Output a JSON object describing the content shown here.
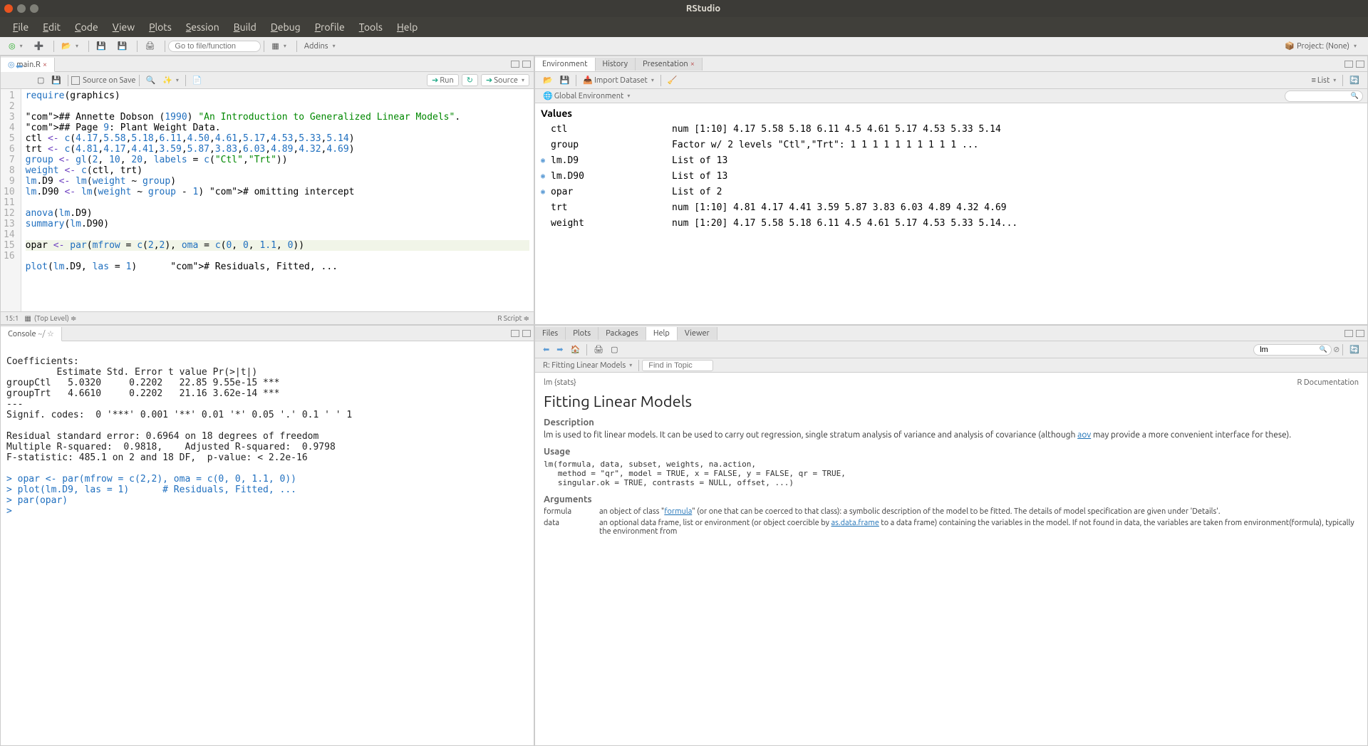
{
  "window": {
    "title": "RStudio"
  },
  "menu": [
    "File",
    "Edit",
    "Code",
    "View",
    "Plots",
    "Session",
    "Build",
    "Debug",
    "Profile",
    "Tools",
    "Help"
  ],
  "top_toolbar": {
    "goto_placeholder": "Go to file/function",
    "addins_label": "Addins",
    "project_label": "Project: (None)"
  },
  "source": {
    "tab": "main.R",
    "source_on_save": "Source on Save",
    "run": "Run",
    "source_btn": "Source",
    "status_pos": "15:1",
    "status_scope": "(Top Level)",
    "status_lang": "R Script",
    "lines": [
      "require(graphics)",
      "",
      "## Annette Dobson (1990) \"An Introduction to Generalized Linear Models\".",
      "## Page 9: Plant Weight Data.",
      "ctl <- c(4.17,5.58,5.18,6.11,4.50,4.61,5.17,4.53,5.33,5.14)",
      "trt <- c(4.81,4.17,4.41,3.59,5.87,3.83,6.03,4.89,4.32,4.69)",
      "group <- gl(2, 10, 20, labels = c(\"Ctl\",\"Trt\"))",
      "weight <- c(ctl, trt)",
      "lm.D9 <- lm(weight ~ group)",
      "lm.D90 <- lm(weight ~ group - 1) # omitting intercept",
      "",
      "anova(lm.D9)",
      "summary(lm.D90)",
      "",
      "opar <- par(mfrow = c(2,2), oma = c(0, 0, 1.1, 0))",
      "plot(lm.D9, las = 1)      # Residuals, Fitted, ..."
    ],
    "highlight_line": 15
  },
  "console": {
    "title": "Console",
    "cwd": "~/",
    "output": "Coefficients:\n         Estimate Std. Error t value Pr(>|t|)    \ngroupCtl   5.0320     0.2202   22.85 9.55e-15 ***\ngroupTrt   4.6610     0.2202   21.16 3.62e-14 ***\n---\nSignif. codes:  0 '***' 0.001 '**' 0.01 '*' 0.05 '.' 0.1 ' ' 1\n\nResidual standard error: 0.6964 on 18 degrees of freedom\nMultiple R-squared:  0.9818,\tAdjusted R-squared:  0.9798 \nF-statistic: 485.1 on 2 and 18 DF,  p-value: < 2.2e-16\n",
    "history": [
      "opar <- par(mfrow = c(2,2), oma = c(0, 0, 1.1, 0))",
      "plot(lm.D9, las = 1)      # Residuals, Fitted, ...",
      "par(opar)"
    ]
  },
  "env_pane": {
    "tabs": [
      "Environment",
      "History",
      "Presentation"
    ],
    "active": 0,
    "import_label": "Import Dataset",
    "scope": "Global Environment",
    "list_label": "List",
    "heading": "Values",
    "rows": [
      {
        "expand": false,
        "name": "ctl",
        "value": "num [1:10] 4.17 5.58 5.18 6.11 4.5 4.61 5.17 4.53 5.33 5.14"
      },
      {
        "expand": false,
        "name": "group",
        "value": "Factor w/ 2 levels \"Ctl\",\"Trt\": 1 1 1 1 1 1 1 1 1 1 ..."
      },
      {
        "expand": true,
        "name": "lm.D9",
        "value": "List of 13"
      },
      {
        "expand": true,
        "name": "lm.D90",
        "value": "List of 13"
      },
      {
        "expand": true,
        "name": "opar",
        "value": "List of 2"
      },
      {
        "expand": false,
        "name": "trt",
        "value": "num [1:10] 4.81 4.17 4.41 3.59 5.87 3.83 6.03 4.89 4.32 4.69"
      },
      {
        "expand": false,
        "name": "weight",
        "value": "num [1:20] 4.17 5.58 5.18 6.11 4.5 4.61 5.17 4.53 5.33 5.14..."
      }
    ]
  },
  "help_pane": {
    "tabs": [
      "Files",
      "Plots",
      "Packages",
      "Help",
      "Viewer"
    ],
    "active": 3,
    "search_value": "lm",
    "topic_label": "R: Fitting Linear Models",
    "find_placeholder": "Find in Topic",
    "pkg": "lm {stats}",
    "doc_label": "R Documentation",
    "title": "Fitting Linear Models",
    "desc_h": "Description",
    "desc": "lm is used to fit linear models. It can be used to carry out regression, single stratum analysis of variance and analysis of covariance (although ",
    "desc_link": "aov",
    "desc2": " may provide a more convenient interface for these).",
    "usage_h": "Usage",
    "usage": "lm(formula, data, subset, weights, na.action,\n   method = \"qr\", model = TRUE, x = FALSE, y = FALSE, qr = TRUE,\n   singular.ok = TRUE, contrasts = NULL, offset, ...)",
    "args_h": "Arguments",
    "args": [
      {
        "name": "formula",
        "desc_pre": "an object of class \"",
        "link": "formula",
        "desc_post": "\" (or one that can be coerced to that class): a symbolic description of the model to be fitted. The details of model specification are given under 'Details'."
      },
      {
        "name": "data",
        "desc_pre": "an optional data frame, list or environment (or object coercible by ",
        "link": "as.data.frame",
        "desc_post": " to a data frame) containing the variables in the model. If not found in data, the variables are taken from environment(formula), typically the environment from"
      }
    ]
  }
}
